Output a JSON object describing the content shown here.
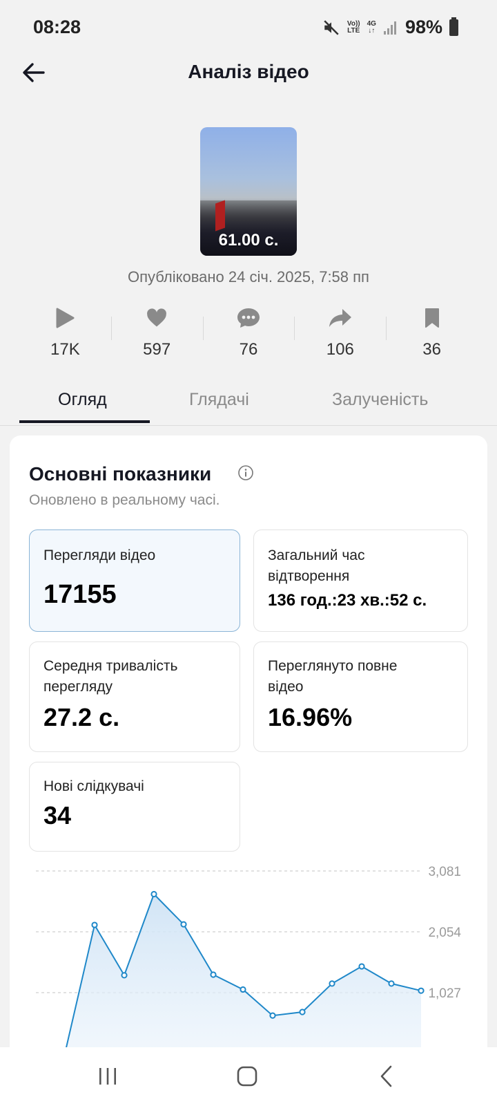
{
  "status_bar": {
    "time": "08:28",
    "volte_label_top": "Vo))",
    "volte_label_bottom": "LTE",
    "network_label": "4G",
    "battery": "98%",
    "icons": [
      "mute-icon",
      "signal-icon",
      "battery-icon"
    ]
  },
  "header": {
    "title": "Аналіз відео",
    "back_icon": "arrow-left-icon"
  },
  "video": {
    "duration": "61.00 с.",
    "published": "Опубліковано 24 січ. 2025, 7:58 пп"
  },
  "stats": [
    {
      "icon": "play-icon",
      "value": "17K"
    },
    {
      "icon": "heart-icon",
      "value": "597"
    },
    {
      "icon": "comment-icon",
      "value": "76"
    },
    {
      "icon": "share-icon",
      "value": "106"
    },
    {
      "icon": "bookmark-icon",
      "value": "36"
    }
  ],
  "tabs": [
    {
      "label": "Огляд",
      "active": true
    },
    {
      "label": "Глядачі",
      "active": false
    },
    {
      "label": "Залученість",
      "active": false
    }
  ],
  "overview": {
    "title": "Основні показники",
    "subtitle": "Оновлено в реальному часі.",
    "metrics": [
      {
        "label": "Перегляди відео",
        "value": "17155",
        "selected": true
      },
      {
        "label": "Загальний час відтворення",
        "value": "136 год.:23 хв.:52 с.",
        "selected": false
      },
      {
        "label": "Середня тривалість перегляду",
        "value": "27.2 с.",
        "selected": false
      },
      {
        "label": "Переглянуто повне відео",
        "value": "16.96%",
        "selected": false
      },
      {
        "label": "Нові слідкувачі",
        "value": "34",
        "selected": false
      }
    ]
  },
  "chart_data": {
    "type": "area",
    "title": "",
    "xlabel": "",
    "ylabel": "",
    "y_ticks": [
      "3,081",
      "2,054",
      "1,027"
    ],
    "ylim": [
      0,
      3081
    ],
    "color": "#1f88c9",
    "series": [
      {
        "values": [
          0,
          2170,
          1320,
          2690,
          2180,
          1330,
          1080,
          640,
          700,
          1180,
          1470,
          1180,
          1060
        ]
      }
    ]
  },
  "navbar": {
    "buttons": [
      "recents-button",
      "home-button",
      "back-button"
    ]
  }
}
